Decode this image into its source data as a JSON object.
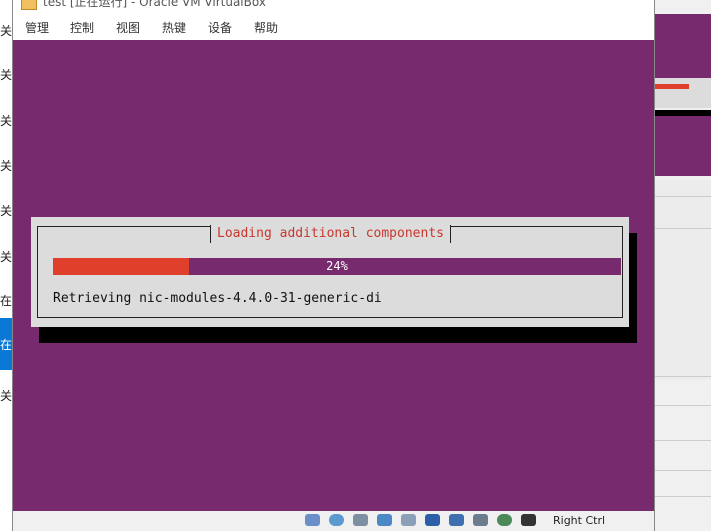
{
  "window": {
    "title": "test [正在运行] - Oracle VM VirtualBox",
    "minimize_label": "—",
    "close_label": "✕"
  },
  "menu": {
    "items": [
      "管理",
      "控制",
      "视图",
      "热键",
      "设备",
      "帮助"
    ]
  },
  "installer": {
    "dialog_title": "Loading additional components",
    "progress_percent": 24,
    "progress_label": "24%",
    "status_text": "Retrieving nic-modules-4.4.0-31-generic-di"
  },
  "statusbar": {
    "host_key": "Right Ctrl"
  },
  "background_fragments": {
    "left": [
      "关",
      "关",
      "关",
      "关",
      "关",
      "关",
      "在",
      "在",
      "关"
    ]
  },
  "colors": {
    "screen_bg": "#772a6e",
    "progress_fill": "#e0402b",
    "dialog_bg": "#dcdcdc",
    "dialog_title": "#c8372d"
  }
}
